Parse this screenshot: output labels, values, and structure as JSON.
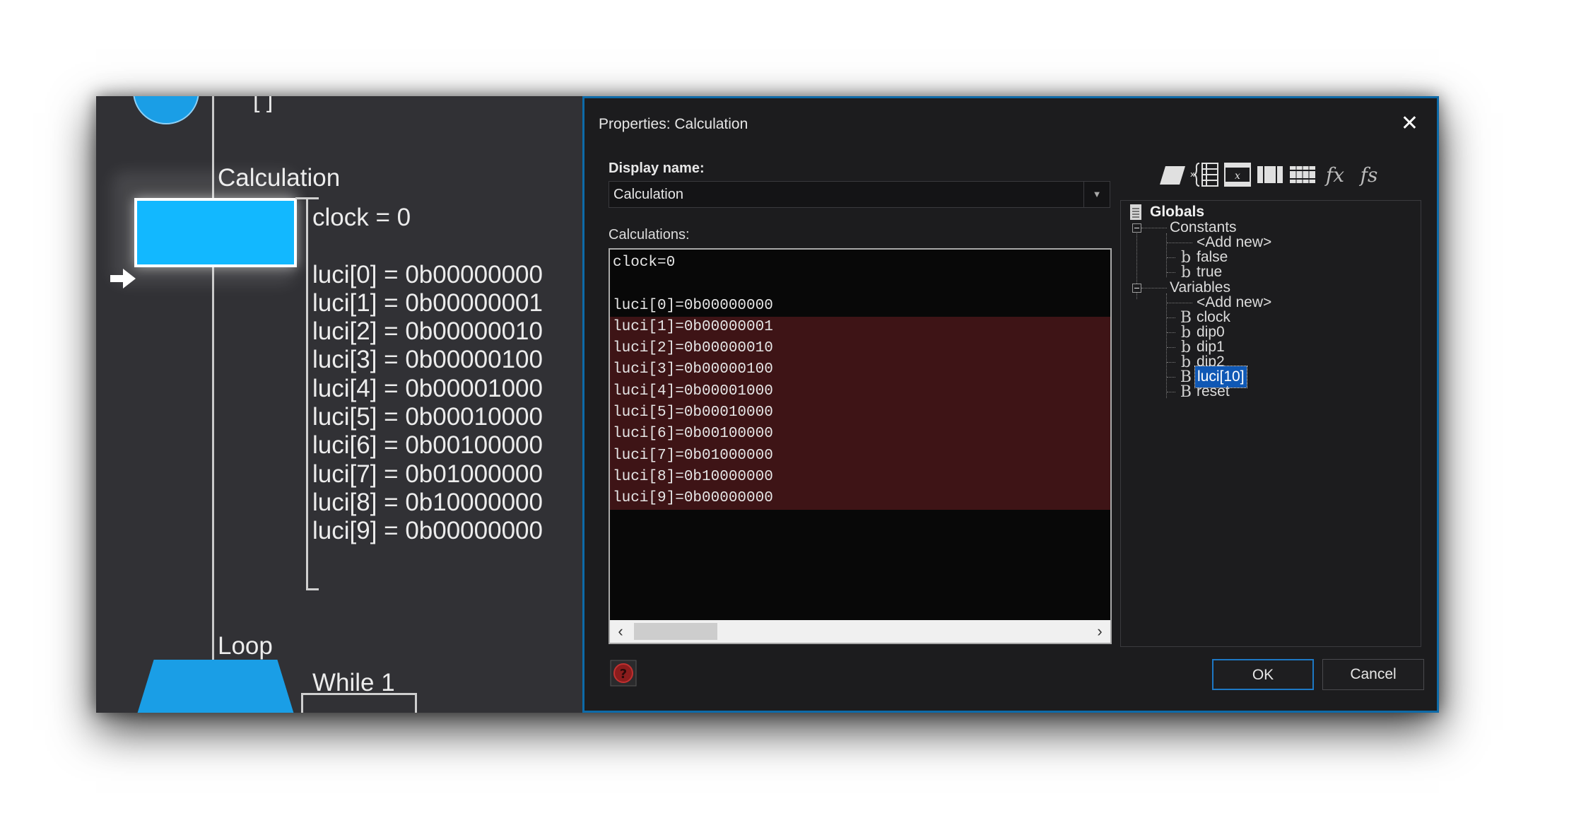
{
  "canvas": {
    "top_partial": "[ ]",
    "calc_node_title": "Calculation",
    "calc_lines": [
      "clock = 0",
      "",
      "luci[0] = 0b00000000",
      "luci[1] = 0b00000001",
      "luci[2] = 0b00000010",
      "luci[3] = 0b00000100",
      "luci[4] = 0b00001000",
      "luci[5] = 0b00010000",
      "luci[6] = 0b00100000",
      "luci[7] = 0b01000000",
      "luci[8] = 0b10000000",
      "luci[9] = 0b00000000"
    ],
    "loop_node_title": "Loop",
    "loop_condition": "While 1",
    "colors": {
      "node_fill": "#12b8ff",
      "loop_fill": "#1a9ee6",
      "background": "#313135"
    }
  },
  "dialog": {
    "title": "Properties: Calculation",
    "close_icon": "close-icon",
    "display_name_label": "Display name:",
    "display_name_value": "Calculation",
    "calculations_label": "Calculations:",
    "code_lines": [
      "clock=0",
      "",
      "luci[0]=0b00000000",
      "luci[1]=0b00000001",
      "luci[2]=0b00000010",
      "luci[3]=0b00000100",
      "luci[4]=0b00001000",
      "luci[5]=0b00010000",
      "luci[6]=0b00100000",
      "luci[7]=0b01000000",
      "luci[8]=0b10000000",
      "luci[9]=0b00000000"
    ],
    "selected_code_lines": [
      3,
      4,
      5,
      6,
      7,
      8,
      9,
      10,
      11
    ],
    "toolbar_icons": [
      "parallelogram-icon",
      "array-index-icon",
      "matrix-icon",
      "column-icon",
      "row-icon",
      "function-icon",
      "string-function-icon"
    ],
    "tree": {
      "root": "Globals",
      "constants_label": "Constants",
      "constants_add": "<Add new>",
      "constants": [
        "false",
        "true"
      ],
      "variables_label": "Variables",
      "variables_add": "<Add new>",
      "variables": [
        "clock",
        "dip0",
        "dip1",
        "dip2",
        "luci[10]",
        "reset"
      ],
      "selected_variable": "luci[10]"
    },
    "ok_label": "OK",
    "cancel_label": "Cancel",
    "colors": {
      "accent": "#1d78c4",
      "selection": "#3e1416",
      "tree_highlight": "#0f58b5"
    }
  }
}
